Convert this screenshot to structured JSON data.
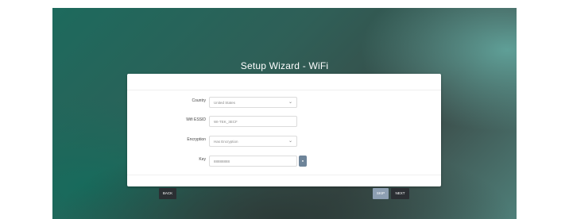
{
  "wizard": {
    "title": "Setup Wizard - WiFi",
    "country": {
      "label": "Country",
      "value": "United States"
    },
    "essid": {
      "label": "Wifi ESSID",
      "value": "WI-TEK_3ECF"
    },
    "encryption": {
      "label": "Encryption",
      "value": "Has Encryption"
    },
    "key": {
      "label": "Key",
      "value": "88888888"
    }
  },
  "buttons": {
    "back": "BACK",
    "skip": "SKIP",
    "next": "NEXT"
  },
  "colors": {
    "skip_button": "#8d9fb2",
    "dark_button": "#2b2f33",
    "background_teal": "#1d6a5d"
  }
}
